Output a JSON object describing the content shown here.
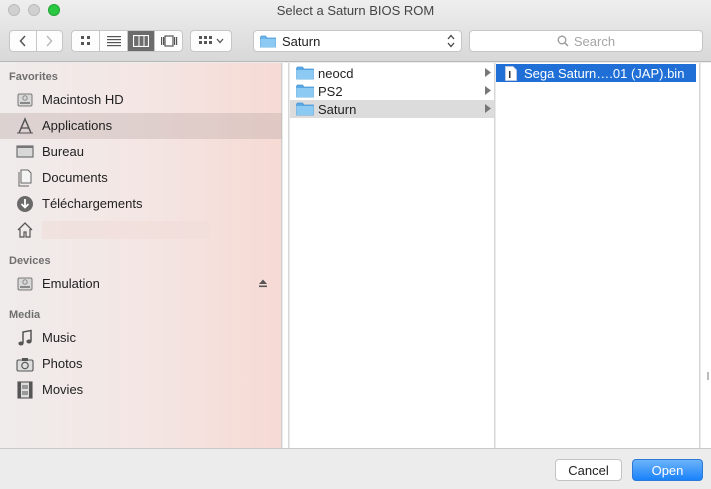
{
  "window": {
    "title": "Select a Saturn BIOS ROM"
  },
  "toolbar": {
    "back_icon": "chevron-left-icon",
    "forward_icon": "chevron-right-icon",
    "views": [
      "icon-view-icon",
      "list-view-icon",
      "column-view-icon",
      "coverflow-view-icon"
    ],
    "active_view": "column",
    "arrange_icon": "arrange-grid-icon",
    "path_popup": {
      "label": "Saturn"
    },
    "search": {
      "placeholder": "Search"
    }
  },
  "sidebar": {
    "favorites_header": "Favorites",
    "favorites": [
      {
        "label": "Macintosh HD",
        "icon": "hard-drive-icon"
      },
      {
        "label": "Applications",
        "icon": "applications-icon",
        "selected": true
      },
      {
        "label": "Bureau",
        "icon": "desktop-icon"
      },
      {
        "label": "Documents",
        "icon": "documents-icon"
      },
      {
        "label": "Téléchargements",
        "icon": "downloads-icon"
      },
      {
        "label": "",
        "icon": "home-icon"
      }
    ],
    "devices_header": "Devices",
    "devices": [
      {
        "label": "Emulation",
        "icon": "hard-drive-icon",
        "eject": true
      }
    ],
    "media_header": "Media",
    "media": [
      {
        "label": "Music",
        "icon": "music-note-icon"
      },
      {
        "label": "Photos",
        "icon": "camera-icon"
      },
      {
        "label": "Movies",
        "icon": "film-icon"
      }
    ]
  },
  "columns": {
    "folders": [
      {
        "label": "neocd",
        "icon": "folder-icon",
        "selected": false
      },
      {
        "label": "PS2",
        "icon": "folder-icon",
        "selected": false
      },
      {
        "label": "Saturn",
        "icon": "folder-icon",
        "selected": true
      }
    ],
    "files": [
      {
        "label": "Sega Saturn….01 (JAP).bin",
        "icon": "file-icon",
        "selected": true
      }
    ]
  },
  "buttons": {
    "cancel": "Cancel",
    "open": "Open"
  },
  "colors": {
    "accent": "#1f6fd6",
    "folder": "#6ab5ee",
    "open_button": "#1a82fb"
  }
}
